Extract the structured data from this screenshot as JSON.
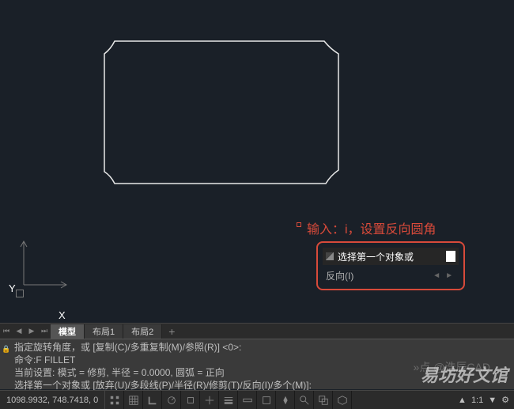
{
  "canvas": {
    "ucs": {
      "x_label": "X",
      "y_label": "Y"
    }
  },
  "annotation": {
    "text": "输入：i，设置反向圆角"
  },
  "dynamic_prompt": {
    "line1": "选择第一个对象或",
    "line2": "反向(I)"
  },
  "tabs": {
    "items": [
      {
        "label": "模型",
        "active": true
      },
      {
        "label": "布局1",
        "active": false
      },
      {
        "label": "布局2",
        "active": false
      }
    ]
  },
  "command_window": {
    "lines": [
      "指定旋转角度，或 [复制(C)/多重复制(M)/参照(R)] <0>:",
      "命令:F FILLET",
      "当前设置: 模式 = 修剪, 半径 = 0.0000, 圆弧 = 正向",
      "选择第一个对象或 [放弃(U)/多段线(P)/半径(R)/修剪(T)/反向(I)/多个(M)]:"
    ]
  },
  "status": {
    "coords": "1098.9932, 748.7418, 0",
    "scale": "1:1",
    "anno": "A"
  },
  "watermark": {
    "main": "易坊好文馆",
    "sub": "»点 @浩辰CAD"
  },
  "icons": {
    "first": "⏮",
    "prev": "◀",
    "next": "▶",
    "last": "⏭",
    "add": "+",
    "arrow_l": "◄",
    "arrow_r": "►"
  }
}
